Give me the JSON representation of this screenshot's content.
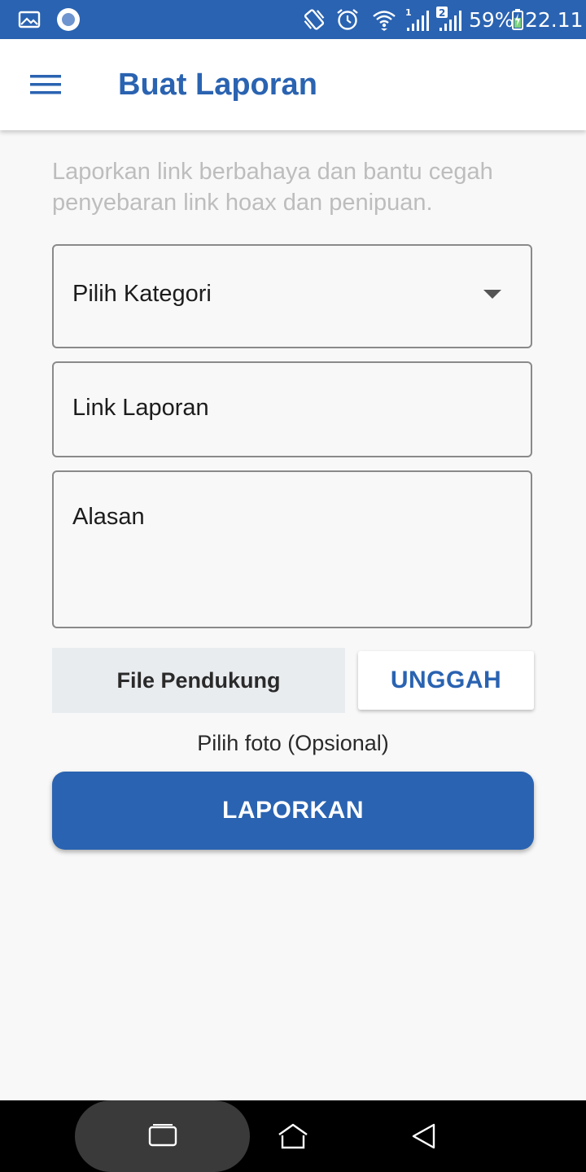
{
  "status_bar": {
    "left_icons": [
      "gallery-icon",
      "circle-notification-icon"
    ],
    "right_icons": [
      "vibrate-icon",
      "alarm-icon",
      "wifi-icon",
      "signal-sim1-icon",
      "signal-sim2-icon",
      "battery-charging-icon"
    ],
    "sim1_label": "1",
    "sim2_label": "2",
    "battery": "59%",
    "time": "22.11"
  },
  "app_bar": {
    "menu_icon": "hamburger-menu-icon",
    "title": "Buat Laporan"
  },
  "form": {
    "intro": "Laporkan link berbahaya dan bantu cegah penyebaran link hoax dan penipuan.",
    "category_select": {
      "value": "Pilih Kategori",
      "icon": "dropdown-arrow-icon"
    },
    "link_field": {
      "placeholder": "Link Laporan"
    },
    "reason_field": {
      "placeholder": "Alasan"
    },
    "file_label": "File Pendukung",
    "upload_button": "UNGGAH",
    "photo_hint": "Pilih foto (Opsional)",
    "submit_button": "LAPORKAN"
  },
  "nav_bar": {
    "buttons": [
      "recent-apps-icon",
      "home-icon",
      "back-icon"
    ]
  },
  "colors": {
    "primary": "#2a63b1",
    "background": "#f8f8f8",
    "intro_text": "#bdbdbd",
    "file_label_bg": "#e9ecef"
  }
}
